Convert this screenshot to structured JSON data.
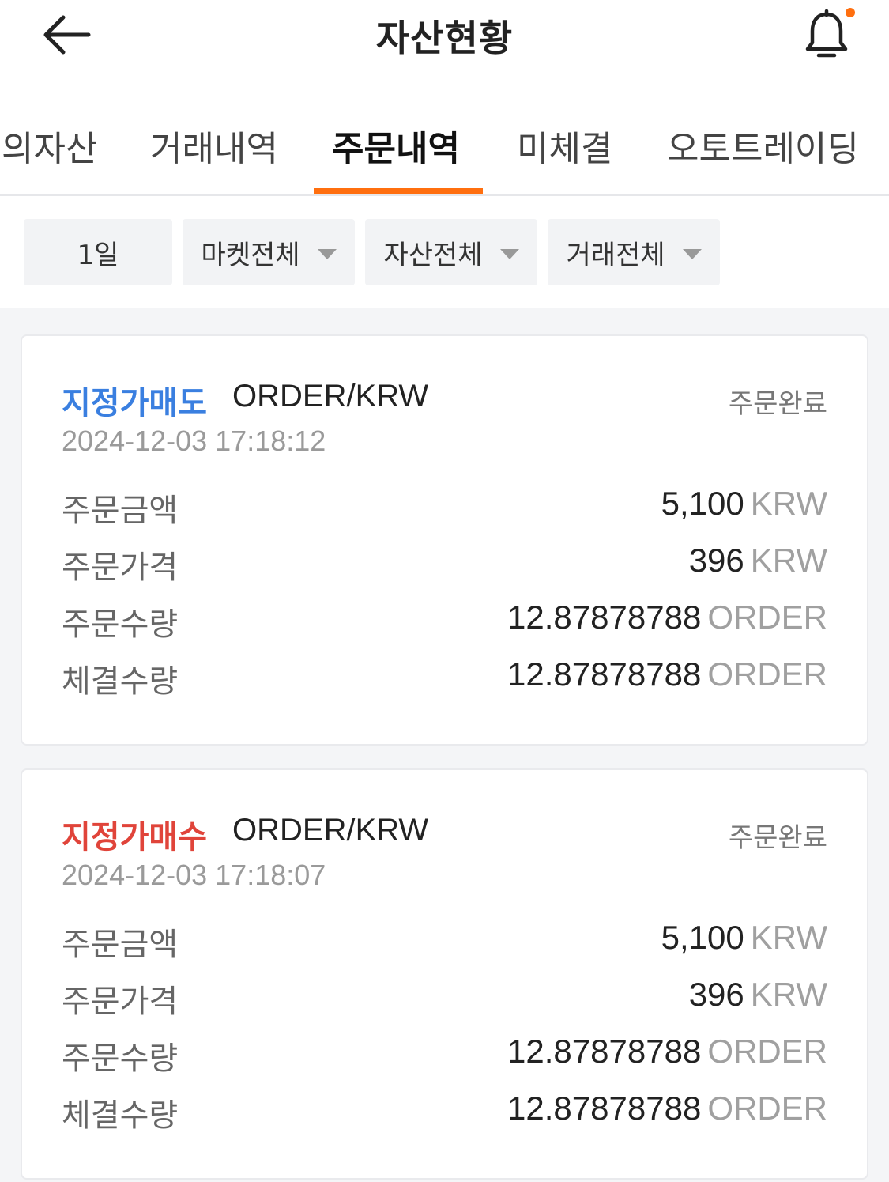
{
  "header": {
    "title": "자산현황",
    "back_icon": "arrow-left-icon",
    "bell_icon": "bell-icon",
    "accent_color": "#ff6f0f"
  },
  "tabs": [
    {
      "label": "의자산",
      "active": false
    },
    {
      "label": "거래내역",
      "active": false
    },
    {
      "label": "주문내역",
      "active": true
    },
    {
      "label": "미체결",
      "active": false
    },
    {
      "label": "오토트레이딩",
      "active": false
    }
  ],
  "filters": [
    {
      "label": "1일",
      "dropdown": false
    },
    {
      "label": "마켓전체",
      "dropdown": true
    },
    {
      "label": "자산전체",
      "dropdown": true
    },
    {
      "label": "거래전체",
      "dropdown": true
    }
  ],
  "orders": [
    {
      "type": "지정가매도",
      "type_color": "#3a7fe0",
      "pair": "ORDER/KRW",
      "status": "주문완료",
      "datetime": "2024-12-03 17:18:12",
      "rows": [
        {
          "label": "주문금액",
          "value": "5,100",
          "unit": "KRW"
        },
        {
          "label": "주문가격",
          "value": "396",
          "unit": "KRW"
        },
        {
          "label": "주문수량",
          "value": "12.87878788",
          "unit": "ORDER"
        },
        {
          "label": "체결수량",
          "value": "12.87878788",
          "unit": "ORDER"
        }
      ]
    },
    {
      "type": "지정가매수",
      "type_color": "#e0443a",
      "pair": "ORDER/KRW",
      "status": "주문완료",
      "datetime": "2024-12-03 17:18:07",
      "rows": [
        {
          "label": "주문금액",
          "value": "5,100",
          "unit": "KRW"
        },
        {
          "label": "주문가격",
          "value": "396",
          "unit": "KRW"
        },
        {
          "label": "주문수량",
          "value": "12.87878788",
          "unit": "ORDER"
        },
        {
          "label": "체결수량",
          "value": "12.87878788",
          "unit": "ORDER"
        }
      ]
    }
  ]
}
